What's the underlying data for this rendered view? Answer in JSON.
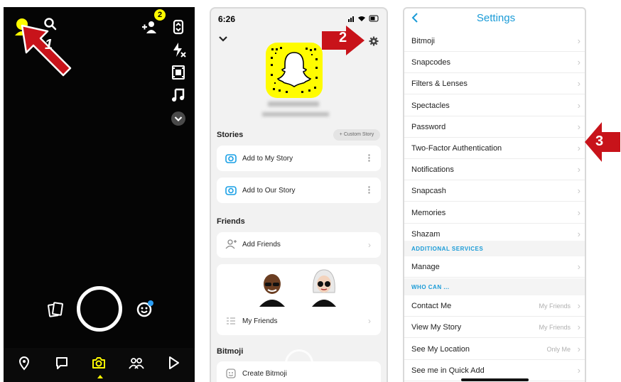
{
  "colors": {
    "snap_yellow": "#fffc00",
    "arrow_red": "#c8131a",
    "settings_blue": "#1a9bd7",
    "notification_blue": "#2a9df4"
  },
  "panel1": {
    "step_label": "1",
    "badge_count": "2",
    "icons": [
      "avatar-icon",
      "search-icon",
      "add-friend-icon",
      "flip-camera-icon",
      "flash-icon",
      "video-icon",
      "music-icon",
      "more-icon",
      "memories-icon",
      "capture-button",
      "lens-icon",
      "map-icon",
      "chat-icon",
      "camera-icon",
      "friends-icon",
      "discover-icon"
    ]
  },
  "panel2": {
    "status_time": "6:26",
    "step_label": "2",
    "stories_title": "Stories",
    "custom_story": "+ Custom Story",
    "add_to_my_story": "Add to My Story",
    "add_to_our_story": "Add to Our Story",
    "friends_title": "Friends",
    "add_friends": "Add Friends",
    "my_friends": "My Friends",
    "bitmoji_title": "Bitmoji",
    "create_bitmoji": "Create Bitmoji"
  },
  "panel3": {
    "step_label": "3",
    "title": "Settings",
    "rows": [
      {
        "label": "Bitmoji",
        "value": ""
      },
      {
        "label": "Snapcodes",
        "value": ""
      },
      {
        "label": "Filters & Lenses",
        "value": ""
      },
      {
        "label": "Spectacles",
        "value": ""
      },
      {
        "label": "Password",
        "value": ""
      },
      {
        "label": "Two-Factor Authentication",
        "value": ""
      },
      {
        "label": "Notifications",
        "value": ""
      },
      {
        "label": "Snapcash",
        "value": ""
      },
      {
        "label": "Memories",
        "value": ""
      },
      {
        "label": "Shazam",
        "value": ""
      }
    ],
    "additional_services_header": "ADDITIONAL SERVICES",
    "manage": "Manage",
    "who_can_header": "WHO CAN ...",
    "who_can_rows": [
      {
        "label": "Contact Me",
        "value": "My Friends"
      },
      {
        "label": "View My Story",
        "value": "My Friends"
      },
      {
        "label": "See My Location",
        "value": "Only Me"
      },
      {
        "label": "See me in Quick Add",
        "value": ""
      }
    ]
  }
}
